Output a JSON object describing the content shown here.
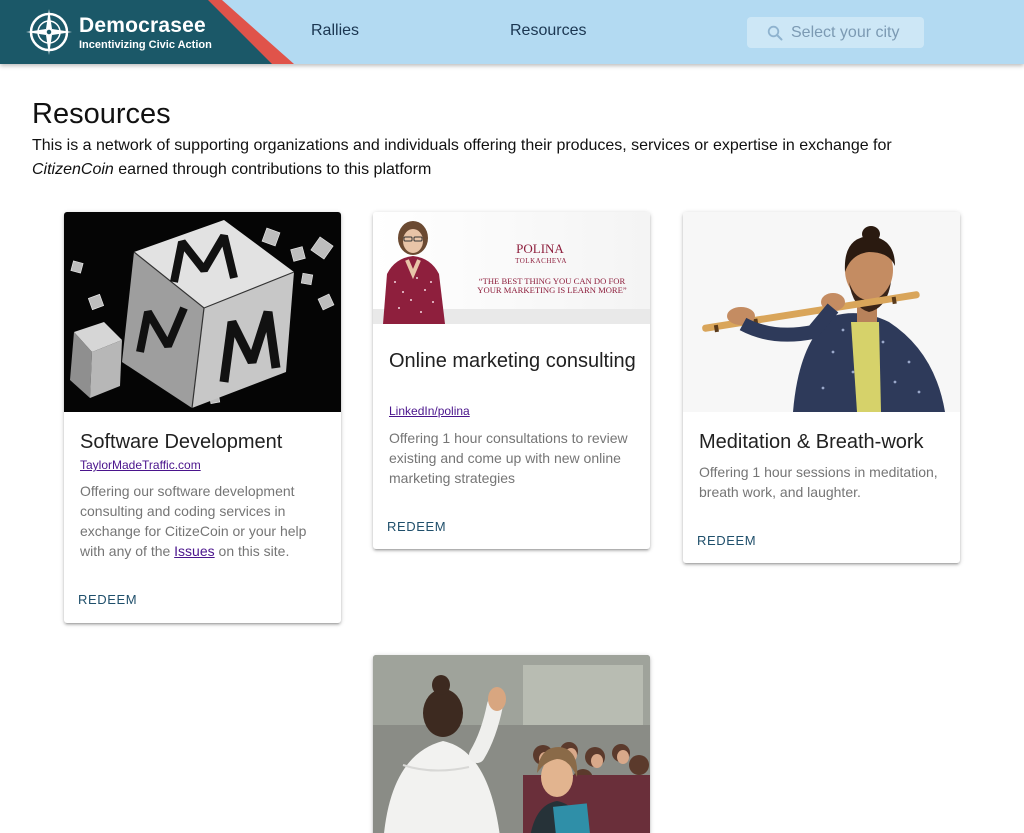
{
  "brand": {
    "name": "Democrasee",
    "tagline": "Incentivizing Civic Action",
    "colors": {
      "dark": "#1b5868",
      "accent": "#e0534a",
      "bar": "#b3daf2"
    }
  },
  "nav": {
    "rallies": "Rallies",
    "resources": "Resources"
  },
  "search": {
    "placeholder": "Select your city",
    "icon": "search-icon"
  },
  "page": {
    "title": "Resources",
    "intro_part1": "This is a network of supporting organizations and individuals offering their produces, services or expertise in exchange for",
    "intro_em": "CitizenCoin",
    "intro_part2": "earned through contributions to this platform"
  },
  "cards": [
    {
      "image": "software-development-cube-image",
      "title": "Software Development",
      "link": "TaylorMadeTraffic.com",
      "text_before": "Offering our software development consulting and coding services in exchange for CitizeCoin or your help with any of the",
      "text_link": "Issues",
      "text_after": "on this site.",
      "action": "REDEEM"
    },
    {
      "image": "polina-tolkacheva-banner-image",
      "banner_name_line1": "POLINA",
      "banner_name_line2": "TOLKACHEVA",
      "banner_quote_line1": "“THE BEST THING YOU CAN DO FOR",
      "banner_quote_line2": "YOUR MARKETING IS LEARN MORE”",
      "title": "Online marketing consulting",
      "link": "LinkedIn/polina",
      "text": "Offering 1 hour consultations to review existing and come up with new online marketing strategies",
      "action": "REDEEM"
    },
    {
      "image": "flute-player-image",
      "title": "Meditation & Breath-work",
      "text": "Offering 1 hour sessions in meditation, breath work, and laughter.",
      "action": "REDEEM"
    },
    {
      "image": "crowd-high-five-image"
    }
  ]
}
